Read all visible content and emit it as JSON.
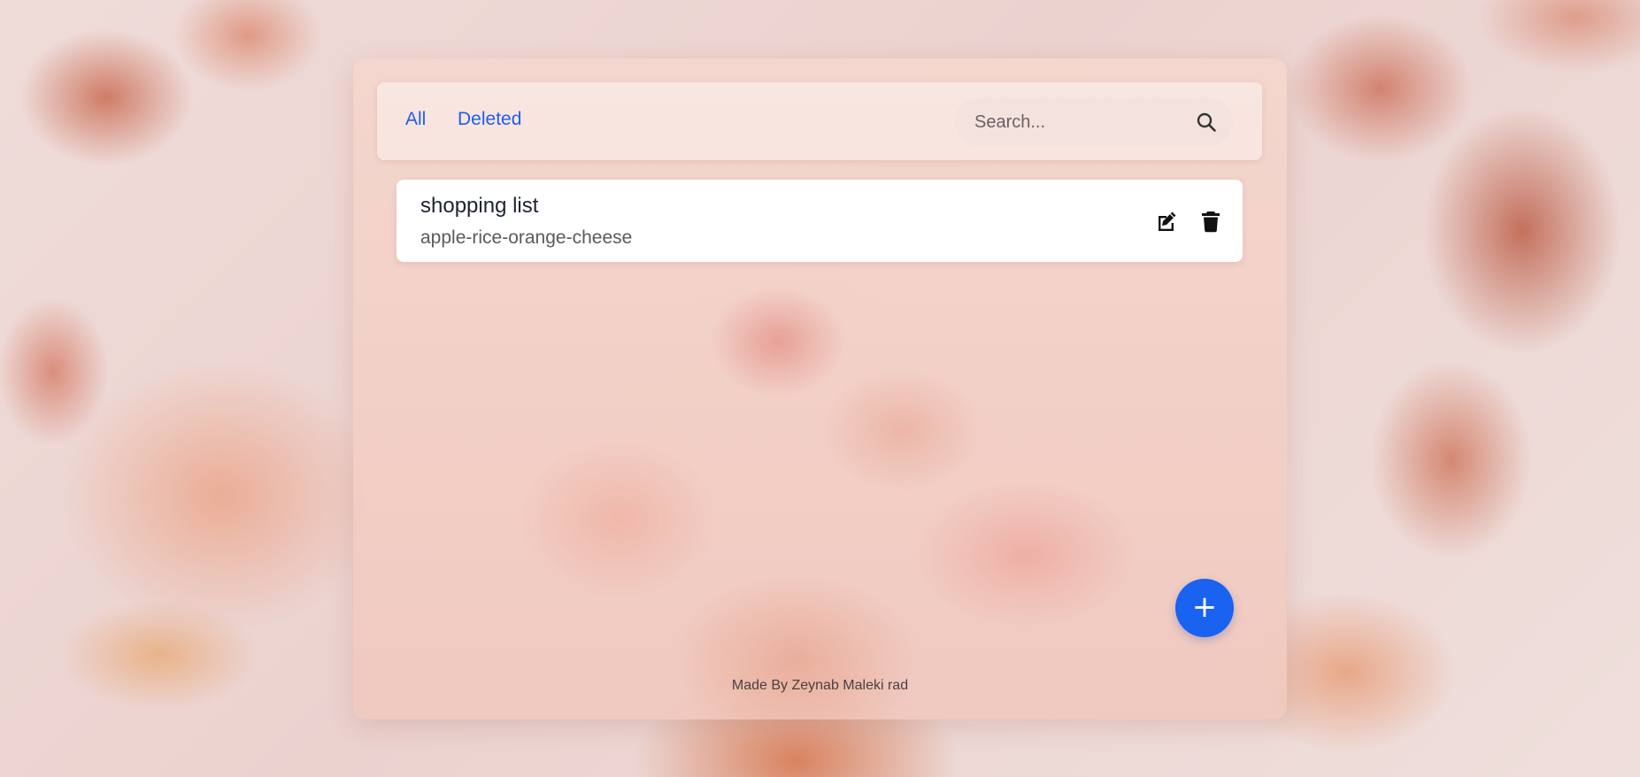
{
  "tabs": {
    "all_label": "All",
    "deleted_label": "Deleted"
  },
  "search": {
    "placeholder": "Search...",
    "value": "",
    "icon": "search-icon"
  },
  "notes": [
    {
      "title": "shopping list",
      "body": "apple-rice-orange-cheese",
      "edit_icon": "edit-icon",
      "delete_icon": "trash-icon"
    }
  ],
  "fab": {
    "label": "+",
    "icon": "plus-icon"
  },
  "footer": {
    "credit": "Made By Zeynab Maleki rad"
  },
  "colors": {
    "accent": "#1a62f0",
    "tab_text": "#1f5ef0",
    "note_bg": "#ffffff"
  }
}
